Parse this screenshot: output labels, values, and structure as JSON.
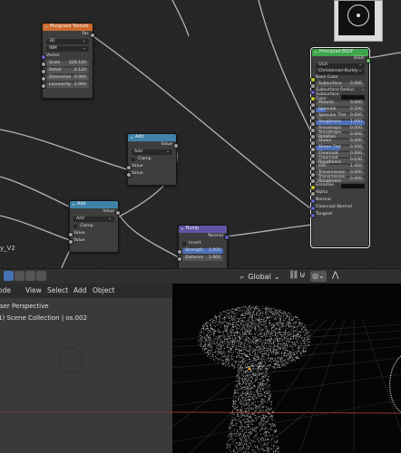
{
  "nodes": {
    "musgrave": {
      "title": "Musgrave Texture",
      "out_fac": "Fac",
      "dim_select": "3D",
      "type_select": "fBM",
      "vector_label": "Vector",
      "fields": [
        {
          "label": "Scale",
          "value": "428.100"
        },
        {
          "label": "Detail",
          "value": "0.120"
        },
        {
          "label": "Dimension",
          "value": "0.000"
        },
        {
          "label": "Lacunarity",
          "value": "2.000"
        }
      ]
    },
    "add1": {
      "title": "Add",
      "out_value": "Value",
      "op_select": "Add",
      "clamp_label": "Clamp",
      "in1": "Value",
      "in2": "Value"
    },
    "add2": {
      "title": "Add",
      "out_value": "Value",
      "op_select": "Add",
      "clamp_label": "Clamp",
      "in1": "Value",
      "in2": "Value"
    },
    "bump": {
      "title": "Bump",
      "out_normal": "Normal",
      "invert_label": "Invert",
      "strength_label": "Strength",
      "strength_value": "1.000",
      "distance_label": "Distance",
      "distance_value": "1.000"
    },
    "bsdf": {
      "title": "Principled BSDF",
      "out_bsdf": "BSDF",
      "dist_select": "GGX",
      "sss_select": "Christensen-Burley",
      "base_color": "Base Color",
      "rows": [
        {
          "label": "Subsurface",
          "value": "0.000",
          "style": "plain"
        },
        {
          "label": "Subsurface Radius",
          "value": "",
          "style": "dropdown"
        },
        {
          "label": "Subsurface Color",
          "value": "",
          "style": "swatch"
        },
        {
          "label": "Metallic",
          "value": "0.000",
          "style": "plain"
        },
        {
          "label": "Specular",
          "value": "0.200",
          "style": "partial"
        },
        {
          "label": "Specular Tint",
          "value": "0.000",
          "style": "plain"
        },
        {
          "label": "Roughness",
          "value": "1.000",
          "style": "full"
        },
        {
          "label": "Anisotropic",
          "value": "0.000",
          "style": "plain"
        },
        {
          "label": "Anisotropic Rotation",
          "value": "0.000",
          "style": "plain"
        },
        {
          "label": "Sheen",
          "value": "0.000",
          "style": "plain"
        },
        {
          "label": "Sheen Tint",
          "value": "0.500",
          "style": "half"
        },
        {
          "label": "Clearcoat",
          "value": "0.000",
          "style": "plain"
        },
        {
          "label": "Clearcoat Roughness",
          "value": "0.030",
          "style": "plain"
        },
        {
          "label": "IOR",
          "value": "1.450",
          "style": "plain"
        },
        {
          "label": "Transmission",
          "value": "0.000",
          "style": "plain"
        },
        {
          "label": "Transmission Roughness",
          "value": "0.000",
          "style": "plain"
        },
        {
          "label": "Emission",
          "value": "",
          "style": "swatch"
        }
      ],
      "inputs": [
        "Alpha",
        "Normal",
        "Clearcoat Normal",
        "Tangent"
      ]
    }
  },
  "frame_label": "y_V2",
  "header": {
    "orientation": "Global",
    "orientation_icon": "orientation-axes-icon",
    "link_icon": "link-icon",
    "snap_icon": "snap-magnet-icon",
    "proportional_icon": "proportional-edit-icon",
    "falloff_icon": "falloff-curve-icon",
    "mode_icons": [
      "select-box-icon",
      "select-extend-icon",
      "select-subtract-icon",
      "select-invert-icon"
    ]
  },
  "viewport_menu": [
    "ode",
    "View",
    "Select",
    "Add",
    "Object"
  ],
  "viewport": {
    "perspective": "lser Perspective",
    "collection": "1) Scene Collection | os.002"
  },
  "colors": {
    "texture_header": "#cc6b2d",
    "converter_header": "#3f83a9",
    "vector_header": "#6454a6",
    "shader_header": "#3fa54c",
    "select_outline": "#e8e8e8",
    "active_blue": "#4772b3"
  }
}
